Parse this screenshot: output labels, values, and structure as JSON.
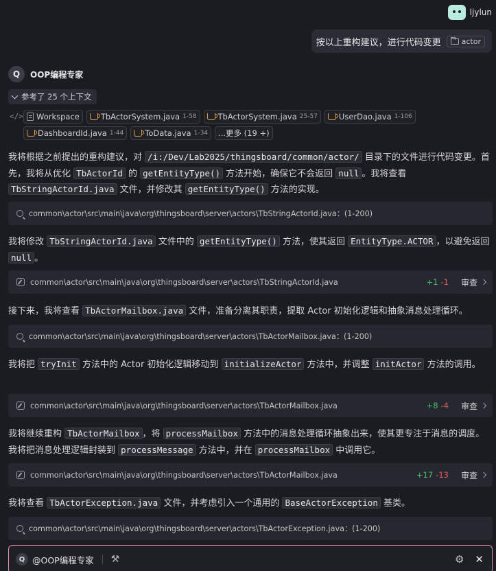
{
  "user": {
    "name": "ljylun"
  },
  "user_message": {
    "text": "按以上重构建议，进行代码变更",
    "chip": "actor"
  },
  "agent": {
    "badge": "Q",
    "name": "OOP编程专家"
  },
  "context": {
    "toggle_label": "参考了 25 个上下文",
    "files_row1": [
      {
        "name": "Workspace",
        "range": "",
        "icon": "workspace-icon"
      },
      {
        "name": "TbActorSystem.java",
        "range": "1-58",
        "icon": "java-icon"
      },
      {
        "name": "TbActorSystem.java",
        "range": "25-57",
        "icon": "java-icon"
      },
      {
        "name": "UserDao.java",
        "range": "1-106",
        "icon": "java-icon"
      }
    ],
    "files_row2": [
      {
        "name": "DashboardId.java",
        "range": "1-44",
        "icon": "java-icon"
      },
      {
        "name": "ToData.java",
        "range": "1-34",
        "icon": "java-icon"
      }
    ],
    "more": "...更多 (19 +)"
  },
  "p1": {
    "t1": "我将根据之前提出的重构建议，对 ",
    "c1": "/i:/Dev/Lab2025/thingsboard/common/actor/",
    "t2": " 目录下的文件进行代码变更。首先，我将从优化 ",
    "c2": "TbActorId",
    "t3": " 的 ",
    "c3": "getEntityType()",
    "t4": " 方法开始，确保它不会返回 ",
    "c4": "null",
    "t5": "。我将查看 ",
    "c5": "TbStringActorId.java",
    "t6": " 文件，并修改其 ",
    "c6": "getEntityType()",
    "t7": " 方法的实现。"
  },
  "tool1": {
    "path": "common\\actor\\src\\main\\java\\org\\thingsboard\\server\\actors\\TbStringActorId.java：(1-200)"
  },
  "p2": {
    "t1": "我将修改 ",
    "c1": "TbStringActorId.java",
    "t2": " 文件中的 ",
    "c2": "getEntityType()",
    "t3": " 方法，使其返回 ",
    "c3": "EntityType.ACTOR",
    "t4": "，以避免返回 ",
    "c4": "null",
    "t5": "。"
  },
  "tool2": {
    "path": "common\\actor\\src\\main\\java\\org\\thingsboard\\server\\actors\\TbStringActorId.java",
    "add": "+1",
    "del": "-1",
    "review": "审查"
  },
  "p3": {
    "t1": "接下来，我将查看 ",
    "c1": "TbActorMailbox.java",
    "t2": " 文件，准备分离其职责，提取 Actor 初始化逻辑和抽象消息处理循环。"
  },
  "tool3": {
    "path": "common\\actor\\src\\main\\java\\org\\thingsboard\\server\\actors\\TbActorMailbox.java：(1-200)"
  },
  "p4": {
    "t1": "我将把 ",
    "c1": "tryInit",
    "t2": " 方法中的 Actor 初始化逻辑移动到 ",
    "c2": "initializeActor",
    "t3": " 方法中，并调整 ",
    "c3": "initActor",
    "t4": " 方法的调用。"
  },
  "tool4": {
    "path": "common\\actor\\src\\main\\java\\org\\thingsboard\\server\\actors\\TbActorMailbox.java",
    "add": "+8",
    "del": "-4",
    "review": "审查"
  },
  "p5": {
    "t1": "我将继续重构 ",
    "c1": "TbActorMailbox",
    "t2": "，将 ",
    "c2": "processMailbox",
    "t3": " 方法中的消息处理循环抽象出来，使其更专注于消息的调度。我将把消息处理逻辑封装到 ",
    "c3": "processMessage",
    "t4": " 方法中，并在 ",
    "c4": "processMailbox",
    "t5": " 中调用它。"
  },
  "tool5": {
    "path": "common\\actor\\src\\main\\java\\org\\thingsboard\\server\\actors\\TbActorMailbox.java",
    "add": "+17",
    "del": "-13",
    "review": "审查"
  },
  "p6": {
    "t1": "我将查看 ",
    "c1": "TbActorException.java",
    "t2": " 文件，并考虑引入一个通用的 ",
    "c2": "BaseActorException",
    "t3": " 基类。"
  },
  "tool6": {
    "path": "common\\actor\\src\\main\\java\\org\\thingsboard\\server\\actors\\TbActorException.java：(1-200)"
  },
  "input": {
    "badge": "Q",
    "agent": "@OOP编程专家"
  },
  "colors": {
    "background": "#1b1c21",
    "add": "#4fb972",
    "del": "#e05d5d",
    "input_border": "#e98fb0",
    "java_icon": "#e0a03c"
  }
}
